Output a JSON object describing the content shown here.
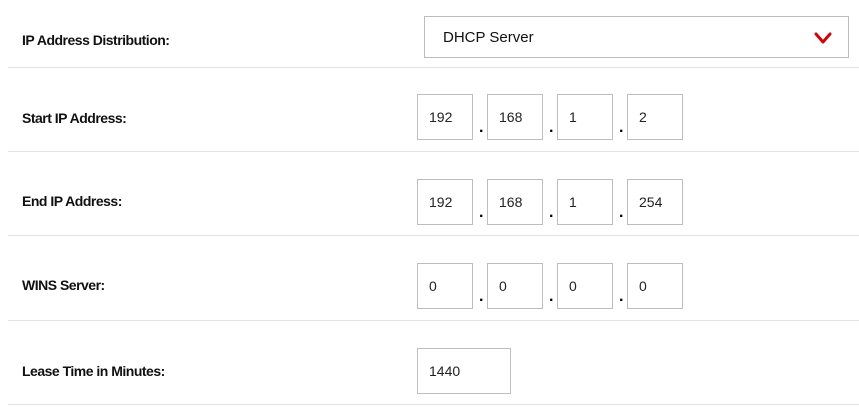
{
  "ip_distribution": {
    "label": "IP Address Distribution:",
    "selected": "DHCP Server",
    "chevron_color": "#cd040b"
  },
  "start_ip": {
    "label": "Start IP Address:",
    "octets": [
      "192",
      "168",
      "1",
      "2"
    ]
  },
  "end_ip": {
    "label": "End IP Address:",
    "octets": [
      "192",
      "168",
      "1",
      "254"
    ]
  },
  "wins_server": {
    "label": "WINS Server:",
    "octets": [
      "0",
      "0",
      "0",
      "0"
    ]
  },
  "lease_time": {
    "label": "Lease Time in Minutes:",
    "value": "1440"
  },
  "separator": "."
}
